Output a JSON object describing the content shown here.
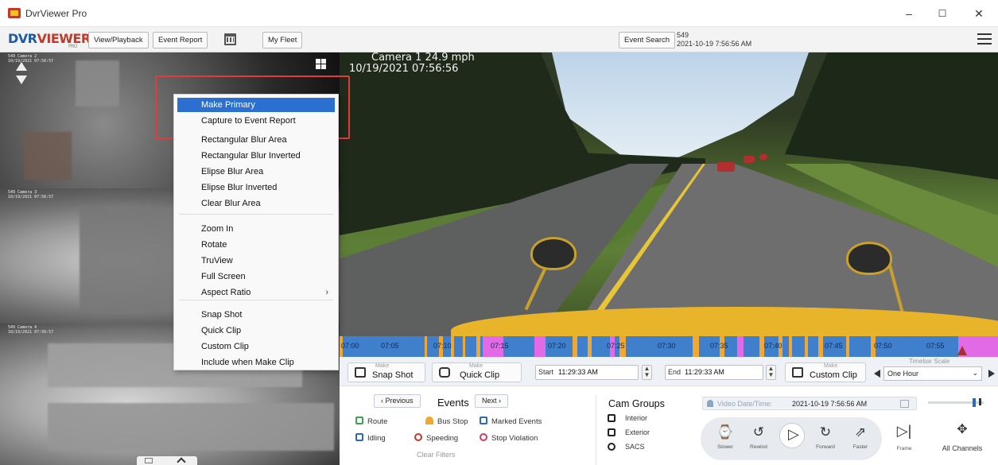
{
  "window": {
    "title": "DvrViewer Pro",
    "minimize": "–",
    "maximize": "☐",
    "close": "✕"
  },
  "toolbar": {
    "logo_dvr": "DVR",
    "logo_viewer": "VIEWER",
    "logo_pro": "PRO",
    "view_playback": "View/Playback",
    "event_report": "Event Report",
    "my_fleet": "My Fleet",
    "event_search": "Event Search",
    "unit_id": "549",
    "unit_datetime": "2021-10-19 7:56:56 AM"
  },
  "main_video": {
    "camera_line": "Camera 1   24.9 mph",
    "time_line": "10/19/2021 07:56:56"
  },
  "context_menu": {
    "items": [
      "Make Primary",
      "Capture to Event Report",
      "Rectangular Blur Area",
      "Rectangular Blur Inverted",
      "Elipse Blur Area",
      "Elipse Blur Inverted",
      "Clear Blur Area",
      "Zoom In",
      "Rotate",
      "TruView",
      "Full Screen",
      "Aspect Ratio",
      "Snap Shot",
      "Quick Clip",
      "Custom Clip",
      "Include when Make Clip"
    ],
    "submenu_arrow": "›"
  },
  "timeline": {
    "labels": [
      "07:00",
      "07:05",
      "07:10",
      "07:15",
      "07:20",
      "07:25",
      "07:30",
      "07:35",
      "07:40",
      "07:45",
      "07:50",
      "07:55"
    ]
  },
  "controls": {
    "make_caption": "Make",
    "snap_shot": "Snap Shot",
    "quick_clip": "Quick Clip",
    "custom_clip": "Custom Clip",
    "start_label": "Start",
    "start_value": "11:29:33 AM",
    "end_label": "End",
    "end_value": "11:29:33 AM",
    "timebar_scale_label": "Timebar Scale",
    "timebar_scale_value": "One Hour",
    "previous": "‹ Previous",
    "events": "Events",
    "next": "Next ›",
    "filters": [
      "Route",
      "Bus Stop",
      "Marked Events",
      "Idling",
      "Speeding",
      "Stop Violation"
    ],
    "clear_filters": "Clear Filters",
    "cam_groups_title": "Cam Groups",
    "cam_groups": [
      "Interior",
      "Exterior",
      "SACS"
    ],
    "video_datetime_label": "Video Date/Time:",
    "video_datetime_value": "2021-10-19 7:56:56 AM",
    "player": {
      "slower": "Slower",
      "rewind": "Rewind",
      "forward": "Forward",
      "faster": "Faster",
      "frame": "Frame",
      "all_channels": "All Channels"
    }
  },
  "colors": {
    "accent": "#3f7fcb",
    "menu_highlight": "#2b6fd1",
    "callout_red": "#e23b3b",
    "timeline_orange": "#f0a830",
    "timeline_magenta": "#e36ae6"
  }
}
